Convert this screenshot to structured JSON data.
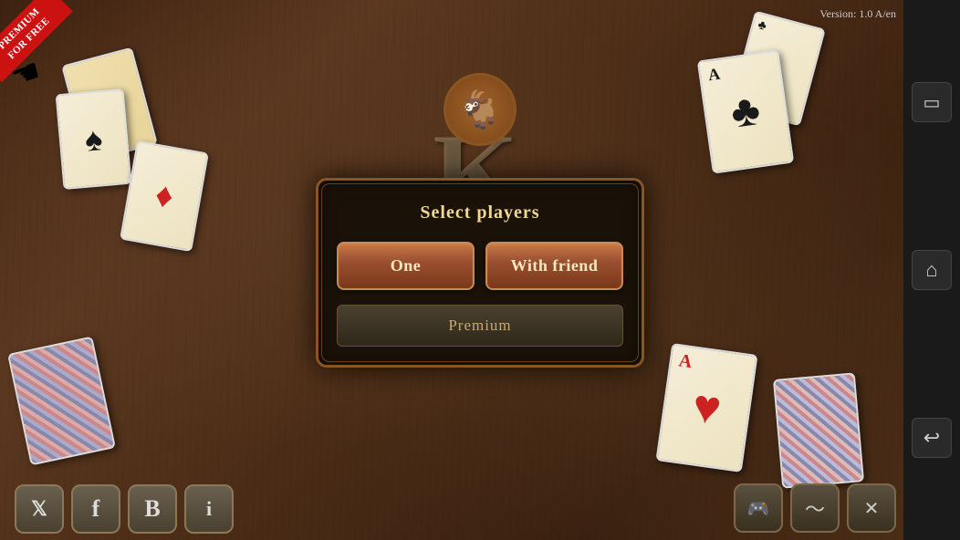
{
  "version": {
    "label": "Version: 1.0 A/en"
  },
  "premium_badge": {
    "line1": "PREMIUM",
    "line2": "FOR FREE"
  },
  "dialog": {
    "title": "Select players",
    "one_button": "One",
    "friend_button": "With friend",
    "premium_button": "Premium"
  },
  "bottom_bar": {
    "twitter_label": "🐦",
    "facebook_label": "f",
    "blog_label": "B",
    "info_label": "i",
    "gamepad_label": "🎮",
    "wave_label": "〜",
    "settings_label": "✕"
  },
  "sidebar": {
    "screen_label": "▭",
    "home_label": "⌂",
    "back_label": "↩"
  }
}
